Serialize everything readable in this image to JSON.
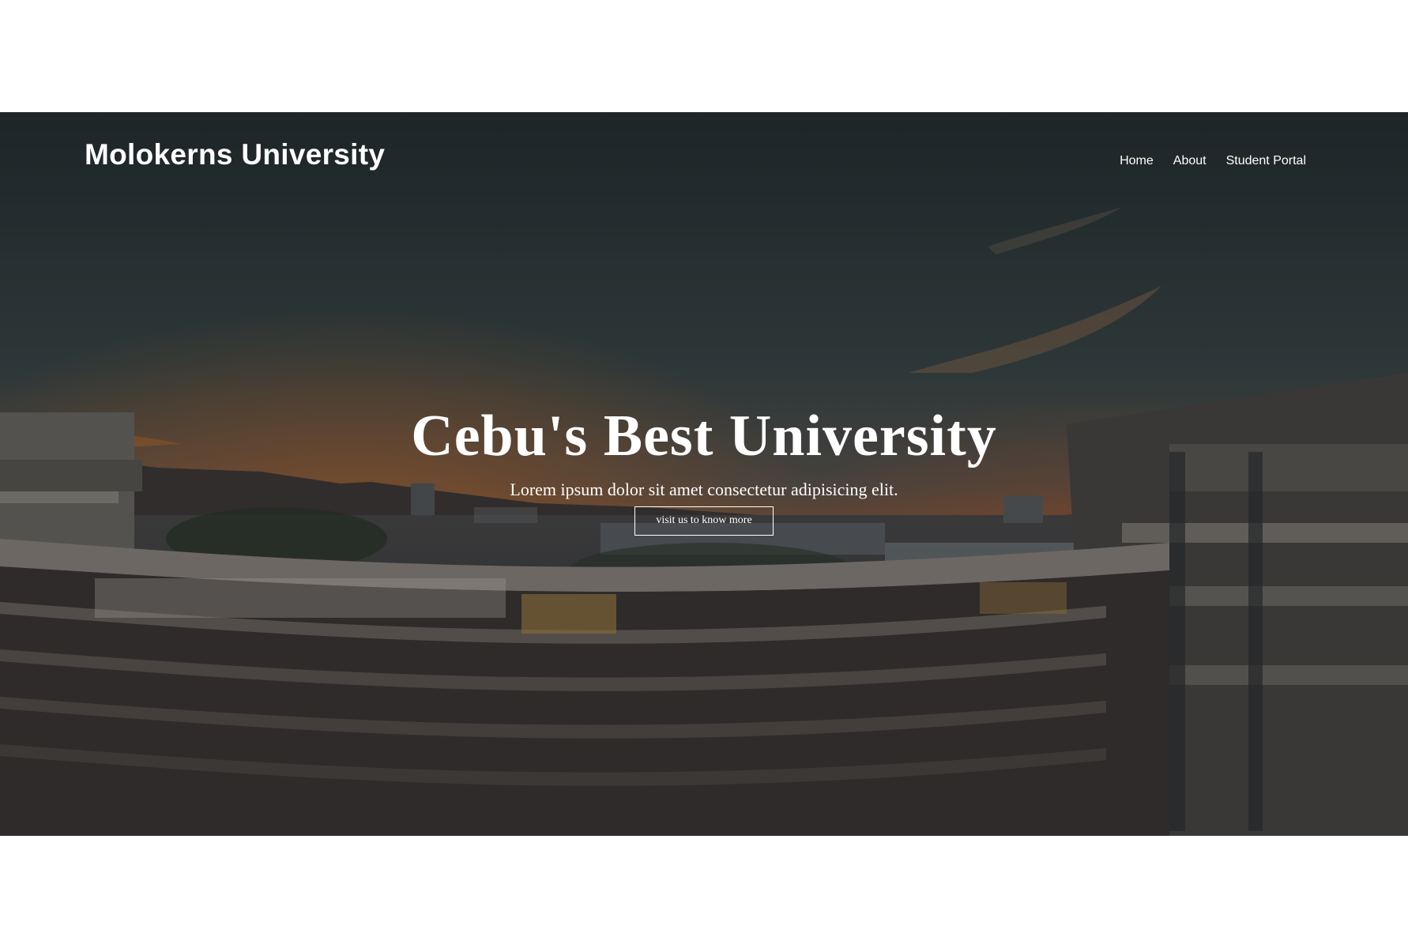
{
  "navbar": {
    "brand": "Molokerns University",
    "links": [
      {
        "label": "Home"
      },
      {
        "label": "About"
      },
      {
        "label": "Student Portal"
      }
    ]
  },
  "hero": {
    "title": "Cebu's Best University",
    "subtitle": "Lorem ipsum dolor sit amet consectetur adipisicing elit.",
    "button_label": "visit us to know more"
  }
}
